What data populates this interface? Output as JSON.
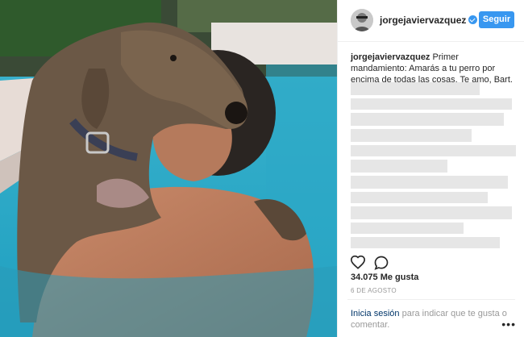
{
  "header": {
    "username": "jorgejaviervazquez",
    "follow_label": "Seguir",
    "verified_icon": "verified-badge-icon"
  },
  "caption": {
    "username": "jorgejaviervazquez",
    "text": "Primer mandamiento: Amarás a tu perro por encima de todas las cosas. Te amo, Bart.",
    "emoji": "💙🐶💙"
  },
  "engagement": {
    "likes": "34.075 Me gusta",
    "date": "6 DE AGOSTO"
  },
  "footer": {
    "login_link": "Inicia sesión",
    "login_text": "para indicar que te gusta o comentar.",
    "more_label": "•••"
  },
  "colors": {
    "accent": "#3897f0",
    "link": "#003569",
    "text": "#262626",
    "muted": "#999999"
  }
}
